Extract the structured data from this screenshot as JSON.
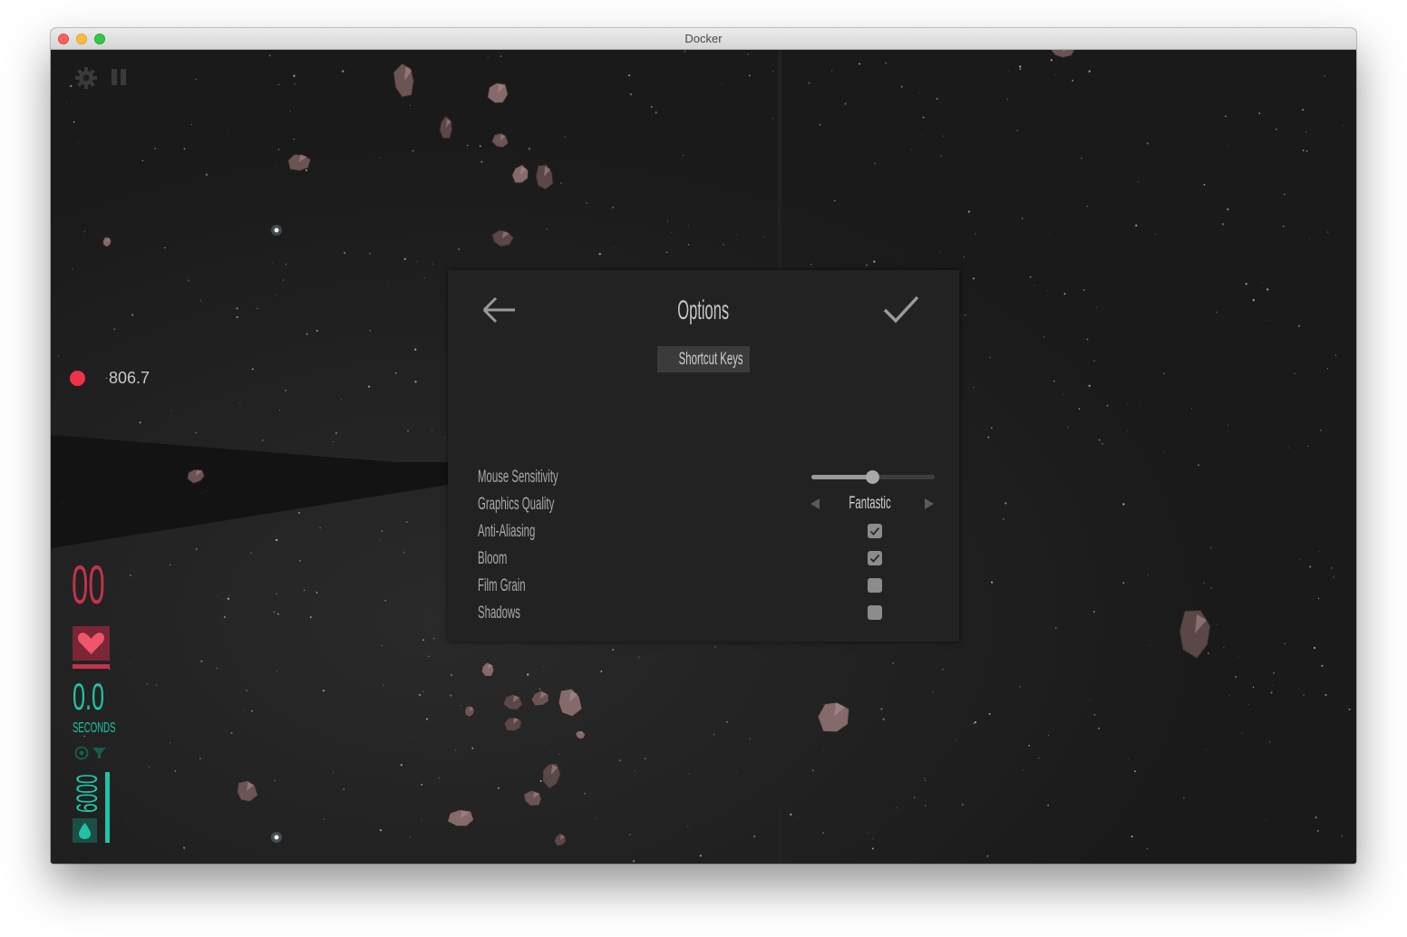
{
  "window": {
    "title": "Docker"
  },
  "hud": {
    "record_value": "806.7",
    "score": "00",
    "time": "0.0",
    "time_unit": "SECONDS",
    "fuel": "6000",
    "colors": {
      "health": "#c3334a",
      "fuel": "#1fc3a2",
      "record": "#ee3346"
    }
  },
  "options": {
    "title": "Options",
    "shortcut_keys": "Shortcut Keys",
    "rows": {
      "mouse_sensitivity": {
        "label": "Mouse Sensitivity",
        "value": 0.5
      },
      "graphics_quality": {
        "label": "Graphics Quality",
        "value": "Fantastic"
      },
      "anti_aliasing": {
        "label": "Anti-Aliasing",
        "checked": true
      },
      "bloom": {
        "label": "Bloom",
        "checked": true
      },
      "film_grain": {
        "label": "Film Grain",
        "checked": false
      },
      "shadows": {
        "label": "Shadows",
        "checked": false
      }
    }
  },
  "icons": [
    "settings-gear-icon",
    "pause-icon",
    "heart-icon",
    "target-icon",
    "filter-icon",
    "droplet-icon",
    "back-arrow-icon",
    "checkmark-icon"
  ]
}
